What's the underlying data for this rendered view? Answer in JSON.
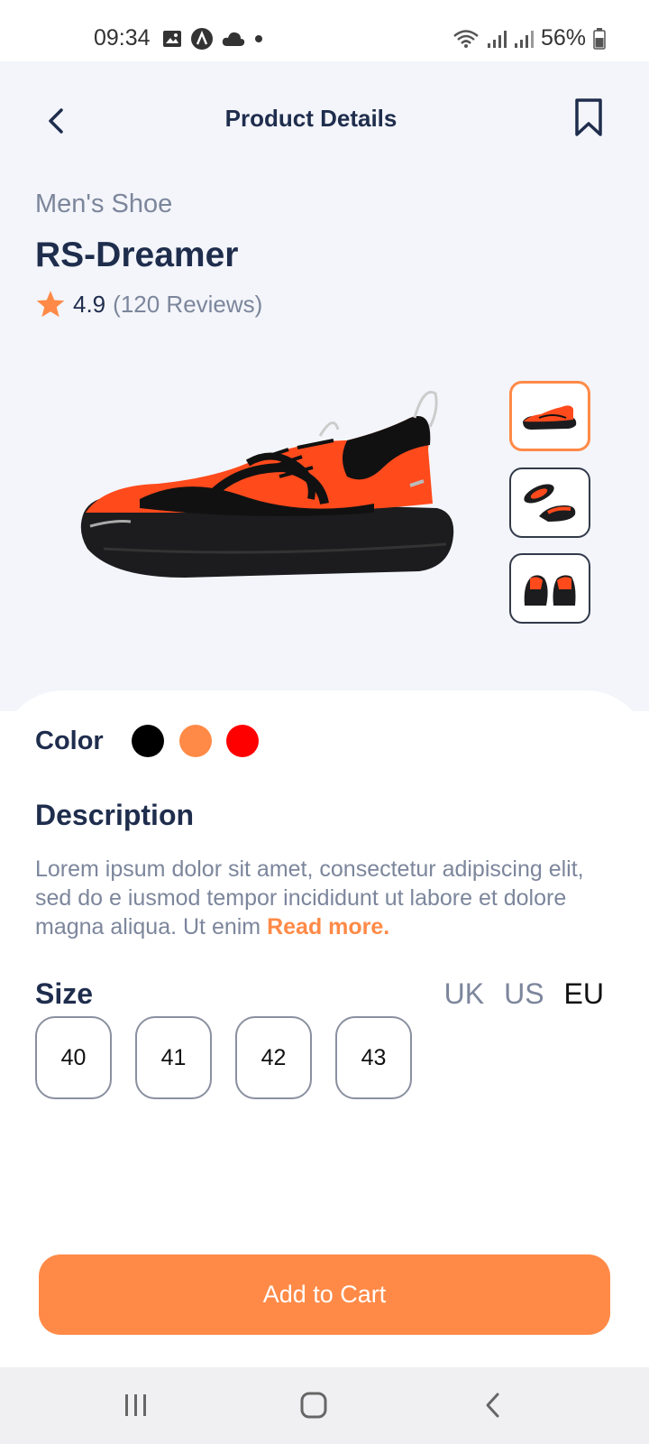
{
  "status_bar": {
    "time": "09:34",
    "battery": "56%",
    "icons_left": [
      "image-icon",
      "a-badge-icon",
      "cloud-icon",
      "dot-icon"
    ],
    "icons_right": [
      "wifi-icon",
      "signal-icon",
      "signal-icon",
      "battery-icon"
    ]
  },
  "header": {
    "title": "Product Details",
    "back_icon": "chevron-left-icon",
    "bookmark_icon": "bookmark-icon"
  },
  "product": {
    "category": "Men's Shoe",
    "name": "RS-Dreamer",
    "rating": "4.9",
    "reviews": "(120 Reviews)",
    "thumbnails": [
      "side-view",
      "top-view",
      "back-view"
    ],
    "selected_thumbnail": 0
  },
  "color": {
    "label": "Color",
    "options": [
      "#000000",
      "#ff8a47",
      "#ff0000"
    ]
  },
  "description": {
    "title": "Description",
    "text": "Lorem ipsum dolor sit amet, consectetur adipiscing elit, sed do e iusmod tempor incididunt ut labore et dolore magna aliqua. Ut enim ",
    "read_more": "Read more."
  },
  "size": {
    "title": "Size",
    "units": [
      "UK",
      "US",
      "EU"
    ],
    "selected_unit": "EU",
    "options": [
      "40",
      "41",
      "42",
      "43"
    ]
  },
  "cart_button": {
    "label": "Add to Cart"
  },
  "colors": {
    "accent": "#ff8a47",
    "text_dark": "#1f2d4d",
    "text_muted": "#7c869c",
    "top_bg": "#f3f5fa"
  }
}
